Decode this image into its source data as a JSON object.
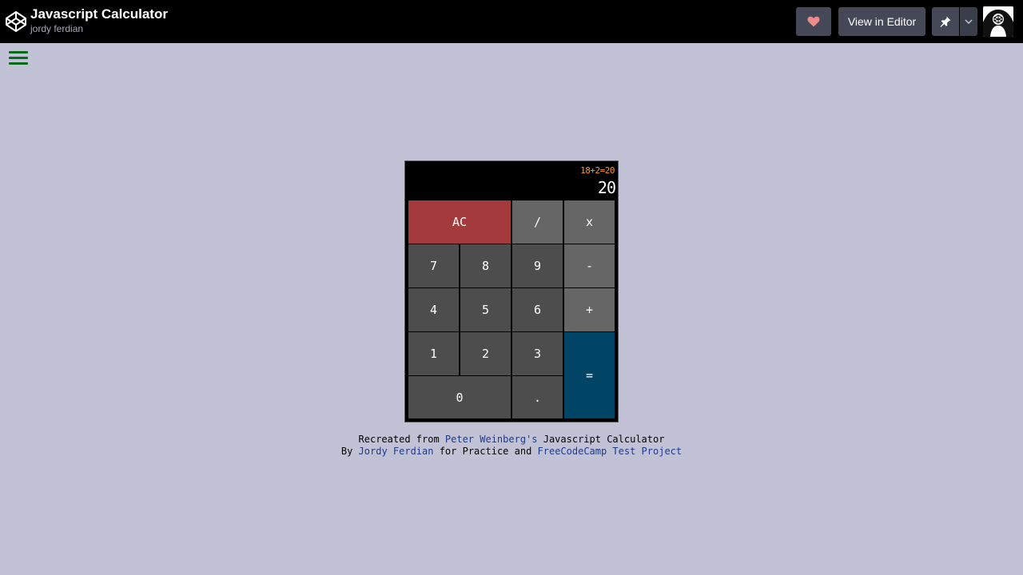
{
  "header": {
    "title": "Javascript Calculator",
    "author": "jordy ferdian",
    "view_in_editor": "View in Editor"
  },
  "colors": {
    "background": "#c2c2d6",
    "topbar": "#000000",
    "heart": "#f08a8a",
    "menu": "#0a6b1a",
    "clear_key": "#a33a3b",
    "equals_key": "#004466",
    "formula_text": "#ff9a1f"
  },
  "calculator": {
    "formula": "18+2=20",
    "output": "20",
    "keys": {
      "clear": "AC",
      "divide": "/",
      "multiply": "x",
      "seven": "7",
      "eight": "8",
      "nine": "9",
      "subtract": "-",
      "four": "4",
      "five": "5",
      "six": "6",
      "add": "+",
      "one": "1",
      "two": "2",
      "three": "3",
      "equals": "=",
      "zero": "0",
      "decimal": "."
    }
  },
  "credits": {
    "line1_prefix": "Recreated from ",
    "line1_link": "Peter Weinberg's",
    "line1_suffix": " Javascript Calculator",
    "line2_prefix": "By ",
    "line2_link1": "Jordy Ferdian",
    "line2_middle": " for Practice and ",
    "line2_link2": "FreeCodeCamp Test Project"
  },
  "icons": {
    "logo": "codepen-logo-icon",
    "heart": "heart-icon",
    "pin": "pin-icon",
    "caret": "chevron-down-icon",
    "menu": "hamburger-menu-icon"
  }
}
